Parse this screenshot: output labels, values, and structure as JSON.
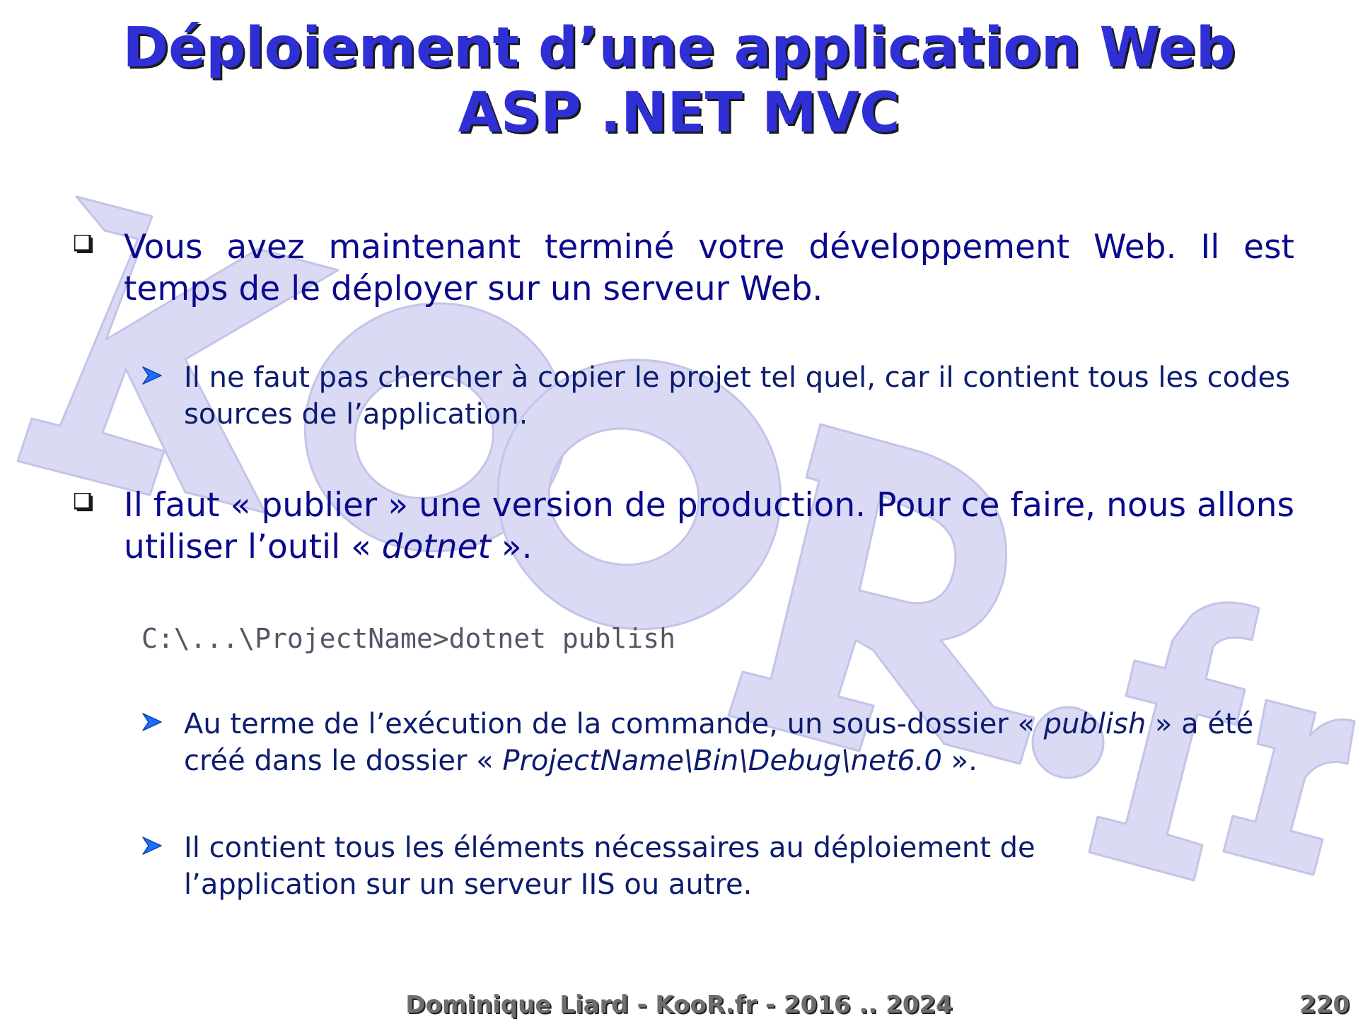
{
  "title": {
    "line1": "Déploiement d’une application Web",
    "line2": "ASP .NET MVC"
  },
  "watermark": {
    "text": "KooR.fr",
    "color": "#dadaf5"
  },
  "bullets": {
    "b1": {
      "text": "Vous avez maintenant terminé votre développement Web. Il est temps de le déployer sur un serveur Web."
    },
    "b1_sub1": {
      "text": "Il ne faut pas chercher à copier le projet tel quel, car il contient tous les codes sources de l’application."
    },
    "b2": {
      "text_before": "Il faut « publier » une version de production. Pour ce faire, nous allons utiliser l’outil « ",
      "italic": "dotnet",
      "text_after": " »."
    },
    "code": "C:\\...\\ProjectName>dotnet publish",
    "b2_sub1": {
      "text_before": "Au terme de l’exécution de la commande, un sous-dossier « ",
      "italic1": "publish",
      "text_middle": " » a été créé dans le dossier « ",
      "italic2": "ProjectName\\Bin\\Debug\\net6.0",
      "text_after": " »."
    },
    "b2_sub2": {
      "text": "Il contient tous les éléments nécessaires au déploiement de l’application sur un serveur IIS ou autre."
    }
  },
  "footer": {
    "author": "Dominique Liard - KooR.fr - 2016 .. 2024",
    "page": "220"
  },
  "colors": {
    "title": "#2f2fd6",
    "level1_text": "#0a0a8c",
    "level2_text": "#0c1c6e",
    "arrow_bullet": "#1a6fff",
    "code_text": "#555566",
    "footer_text": "#6e6e6e"
  }
}
